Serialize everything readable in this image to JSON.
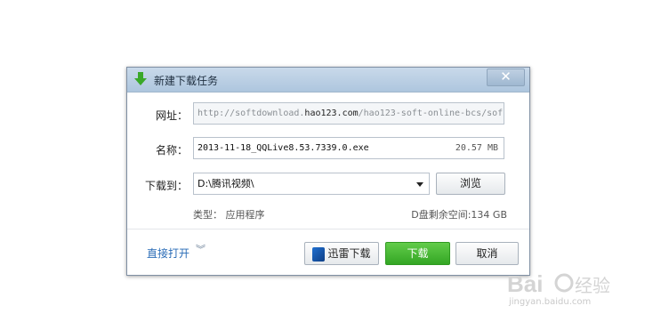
{
  "dialog": {
    "title": "新建下载任务",
    "close_symbol": "✕",
    "url_label": "网址：",
    "url_prefix": "http://softdownload.",
    "url_host": "hao123.com",
    "url_suffix": "/hao123-soft-online-bcs/sof",
    "name_label": "名称：",
    "filename": "2013-11-18_QQLive8.53.7339.0.exe",
    "filesize": "20.57 MB",
    "path_label": "下载到：",
    "path": "D:\\腾讯视频\\",
    "browse_label": "浏览",
    "type_info": "类型： 应用程序",
    "disk_info": "D盘剩余空间:134 GB",
    "direct_open_label": "直接打开",
    "chevron_symbol": "︾",
    "xunlei_label": "迅雷下载",
    "download_label": "下载",
    "cancel_label": "取消"
  },
  "colors": {
    "titlebar": "#aec6de",
    "download_button": "#3fb52c",
    "link": "#2a6cb7"
  },
  "watermark": {
    "brand": "Baidu 经验",
    "url": "jingyan.baidu.com"
  }
}
